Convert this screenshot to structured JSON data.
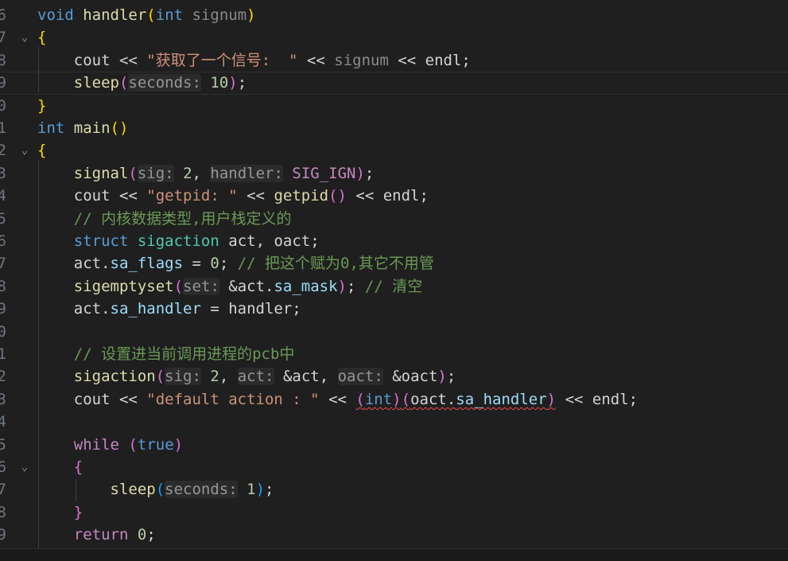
{
  "editor": {
    "lines": [
      {
        "ln": "6",
        "fold": false,
        "tokens": [
          [
            "kw",
            "void"
          ],
          [
            "pn",
            " "
          ],
          [
            "fn",
            "handler"
          ],
          [
            "b1",
            "("
          ],
          [
            "kw",
            "int"
          ],
          [
            "pn",
            " "
          ],
          [
            "dim",
            "signum"
          ],
          [
            "b1",
            ")"
          ]
        ]
      },
      {
        "ln": "7",
        "fold": true,
        "tokens": [
          [
            "b1",
            "{"
          ]
        ]
      },
      {
        "ln": "8",
        "fold": false,
        "tokens": [
          [
            "pn",
            "    cout << "
          ],
          [
            "str",
            "\"获取了一个信号:  \""
          ],
          [
            "pn",
            " << "
          ],
          [
            "dim",
            "signum"
          ],
          [
            "pn",
            " << endl;"
          ]
        ]
      },
      {
        "ln": "9",
        "fold": false,
        "current": true,
        "tokens": [
          [
            "pn",
            "    "
          ],
          [
            "fn",
            "sleep"
          ],
          [
            "b2",
            "("
          ],
          [
            "hint",
            "seconds:"
          ],
          [
            "pn",
            " "
          ],
          [
            "num",
            "10"
          ],
          [
            "b2",
            ")"
          ],
          [
            "pn",
            ";"
          ]
        ]
      },
      {
        "ln": "0",
        "fold": false,
        "tokens": [
          [
            "b1",
            "}"
          ]
        ]
      },
      {
        "ln": "1",
        "fold": false,
        "tokens": [
          [
            "kw",
            "int"
          ],
          [
            "pn",
            " "
          ],
          [
            "fn",
            "main"
          ],
          [
            "b1",
            "()"
          ]
        ]
      },
      {
        "ln": "2",
        "fold": true,
        "tokens": [
          [
            "b1",
            "{"
          ]
        ]
      },
      {
        "ln": "3",
        "fold": false,
        "tokens": [
          [
            "pn",
            "    "
          ],
          [
            "fn",
            "signal"
          ],
          [
            "b2",
            "("
          ],
          [
            "hint",
            "sig:"
          ],
          [
            "pn",
            " "
          ],
          [
            "num",
            "2"
          ],
          [
            "pn",
            ", "
          ],
          [
            "hint",
            "handler:"
          ],
          [
            "pn",
            " "
          ],
          [
            "mac",
            "SIG_IGN"
          ],
          [
            "b2",
            ")"
          ],
          [
            "pn",
            ";"
          ]
        ]
      },
      {
        "ln": "4",
        "fold": false,
        "tokens": [
          [
            "pn",
            "    cout << "
          ],
          [
            "str",
            "\"getpid: \""
          ],
          [
            "pn",
            " << "
          ],
          [
            "fn",
            "getpid"
          ],
          [
            "b2",
            "()"
          ],
          [
            "pn",
            " << endl;"
          ]
        ]
      },
      {
        "ln": "5",
        "fold": false,
        "tokens": [
          [
            "pn",
            "    "
          ],
          [
            "cmt",
            "// 内核数据类型,用户栈定义的"
          ]
        ]
      },
      {
        "ln": "6",
        "fold": false,
        "tokens": [
          [
            "pn",
            "    "
          ],
          [
            "kw",
            "struct"
          ],
          [
            "pn",
            " "
          ],
          [
            "ty",
            "sigaction"
          ],
          [
            "pn",
            " act, oact;"
          ]
        ]
      },
      {
        "ln": "7",
        "fold": false,
        "tokens": [
          [
            "pn",
            "    act."
          ],
          [
            "var",
            "sa_flags"
          ],
          [
            "pn",
            " = "
          ],
          [
            "num",
            "0"
          ],
          [
            "pn",
            "; "
          ],
          [
            "cmt",
            "// 把这个赋为0,其它不用管"
          ]
        ]
      },
      {
        "ln": "8",
        "fold": false,
        "tokens": [
          [
            "pn",
            "    "
          ],
          [
            "fn",
            "sigemptyset"
          ],
          [
            "b2",
            "("
          ],
          [
            "hint",
            "set:"
          ],
          [
            "pn",
            " &act."
          ],
          [
            "var",
            "sa_mask"
          ],
          [
            "b2",
            ")"
          ],
          [
            "pn",
            "; "
          ],
          [
            "cmt",
            "// 清空"
          ]
        ]
      },
      {
        "ln": "9",
        "fold": false,
        "tokens": [
          [
            "pn",
            "    act."
          ],
          [
            "var",
            "sa_handler"
          ],
          [
            "pn",
            " = handler;"
          ]
        ]
      },
      {
        "ln": "0",
        "fold": false,
        "tokens": []
      },
      {
        "ln": "1",
        "fold": false,
        "tokens": [
          [
            "pn",
            "    "
          ],
          [
            "cmt",
            "// 设置进当前调用进程的pcb中"
          ]
        ]
      },
      {
        "ln": "2",
        "fold": false,
        "tokens": [
          [
            "pn",
            "    "
          ],
          [
            "fn",
            "sigaction"
          ],
          [
            "b2",
            "("
          ],
          [
            "hint",
            "sig:"
          ],
          [
            "pn",
            " "
          ],
          [
            "num",
            "2"
          ],
          [
            "pn",
            ", "
          ],
          [
            "hint",
            "act:"
          ],
          [
            "pn",
            " &act, "
          ],
          [
            "hint",
            "oact:"
          ],
          [
            "pn",
            " &oact"
          ],
          [
            "b2",
            ")"
          ],
          [
            "pn",
            ";"
          ]
        ]
      },
      {
        "ln": "3",
        "fold": false,
        "tokens": [
          [
            "pn",
            "    cout << "
          ],
          [
            "str",
            "\"default action : \""
          ],
          [
            "pn",
            " << "
          ],
          [
            "sq_b2",
            "("
          ],
          [
            "sq_kw",
            "int"
          ],
          [
            "sq_b2",
            ")"
          ],
          [
            "sq_b2",
            "("
          ],
          [
            "sq_pn",
            "oact."
          ],
          [
            "sq_var",
            "sa_handler"
          ],
          [
            "sq_b2",
            ")"
          ],
          [
            "pn",
            " << endl;"
          ]
        ]
      },
      {
        "ln": "4",
        "fold": false,
        "tokens": []
      },
      {
        "ln": "5",
        "fold": false,
        "tokens": [
          [
            "pn",
            "    "
          ],
          [
            "ctl",
            "while"
          ],
          [
            "pn",
            " "
          ],
          [
            "b2",
            "("
          ],
          [
            "kw",
            "true"
          ],
          [
            "b2",
            ")"
          ]
        ]
      },
      {
        "ln": "6",
        "fold": true,
        "tokens": [
          [
            "pn",
            "    "
          ],
          [
            "b2",
            "{"
          ]
        ]
      },
      {
        "ln": "7",
        "fold": false,
        "tokens": [
          [
            "pn",
            "        "
          ],
          [
            "fn",
            "sleep"
          ],
          [
            "b3",
            "("
          ],
          [
            "hint",
            "seconds:"
          ],
          [
            "pn",
            " "
          ],
          [
            "num",
            "1"
          ],
          [
            "b3",
            ")"
          ],
          [
            "pn",
            ";"
          ]
        ]
      },
      {
        "ln": "8",
        "fold": false,
        "tokens": [
          [
            "pn",
            "    "
          ],
          [
            "b2",
            "}"
          ]
        ]
      },
      {
        "ln": "9",
        "fold": false,
        "tokens": [
          [
            "pn",
            "    "
          ],
          [
            "ctl",
            "return"
          ],
          [
            "pn",
            " "
          ],
          [
            "num",
            "0"
          ],
          [
            "pn",
            ";"
          ]
        ]
      }
    ]
  },
  "icons": {
    "fold": "chevron-down-icon",
    "fold_glyph": "⌄"
  }
}
